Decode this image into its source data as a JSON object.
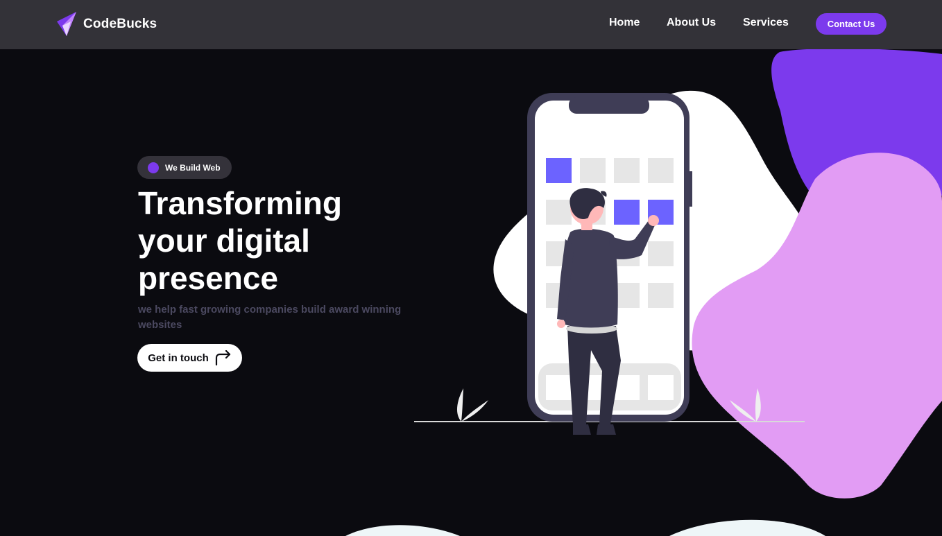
{
  "brand": {
    "name": "CodeBucks",
    "logo_icon": "logo-icon"
  },
  "nav": {
    "links": [
      {
        "label": "Home"
      },
      {
        "label": "About Us"
      },
      {
        "label": "Services"
      }
    ],
    "contact_label": "Contact Us"
  },
  "hero": {
    "badge": "We Build Web",
    "title": "Transforming your digital presence",
    "subtitle": "we help fast growing companies build award winning websites",
    "cta_label": "Get in touch",
    "cta_icon": "arrow-turn-right-icon"
  },
  "illustration": {
    "icon": "person-using-phone-illustration"
  },
  "colors": {
    "background": "#0b0b10",
    "navbar": "#333238",
    "accent": "#7c3aed",
    "lilac": "#e29cf4",
    "tile_active": "#6c63ff"
  }
}
